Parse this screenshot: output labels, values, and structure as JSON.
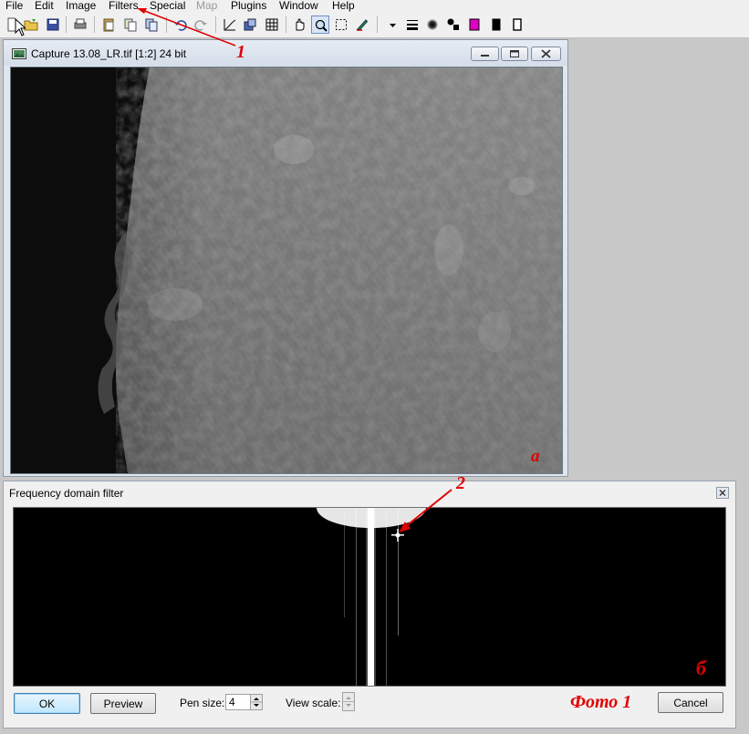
{
  "menu": {
    "items": [
      {
        "label": "File",
        "enabled": true
      },
      {
        "label": "Edit",
        "enabled": true
      },
      {
        "label": "Image",
        "enabled": true
      },
      {
        "label": "Filters",
        "enabled": true
      },
      {
        "label": "Special",
        "enabled": true
      },
      {
        "label": "Map",
        "enabled": false
      },
      {
        "label": "Plugins",
        "enabled": true
      },
      {
        "label": "Window",
        "enabled": true
      },
      {
        "label": "Help",
        "enabled": true
      }
    ]
  },
  "toolbar": {
    "buttons": [
      "new-file-icon",
      "open-folder-icon",
      "save-disk-icon",
      "print-icon",
      "paste-icon",
      "copy-icon",
      "copy-merged-icon",
      "undo-icon",
      "redo-icon",
      "curves-icon",
      "resize-icon",
      "grid-icon",
      "hand-icon",
      "magnifier-icon",
      "selection-icon",
      "pen-icon",
      "dropdown-arrow-icon",
      "line-width-icon",
      "brush-icon",
      "color-swap-icon",
      "foreground-color-swatch",
      "black-color-swatch",
      "white-color-swatch"
    ],
    "colors": {
      "foreground": "#e000c0",
      "black": "#000000",
      "white": "#ffffff"
    }
  },
  "image_window": {
    "title": "Capture 13.08_LR.tif [1:2] 24 bit",
    "annotation_label": "а"
  },
  "dialog": {
    "title": "Frequency domain filter",
    "ok_label": "OK",
    "preview_label": "Preview",
    "pen_size_label": "Pen size:",
    "pen_size_value": "4",
    "view_scale_label": "View scale:",
    "cancel_label": "Cancel",
    "spectrum_annotation_label": "б"
  },
  "annotations": {
    "arrow1_label": "1",
    "arrow2_label": "2",
    "photo_caption": "Фото 1"
  },
  "colors": {
    "annotation_red": "#e00000",
    "accent_blue": "#3c7fb1"
  }
}
